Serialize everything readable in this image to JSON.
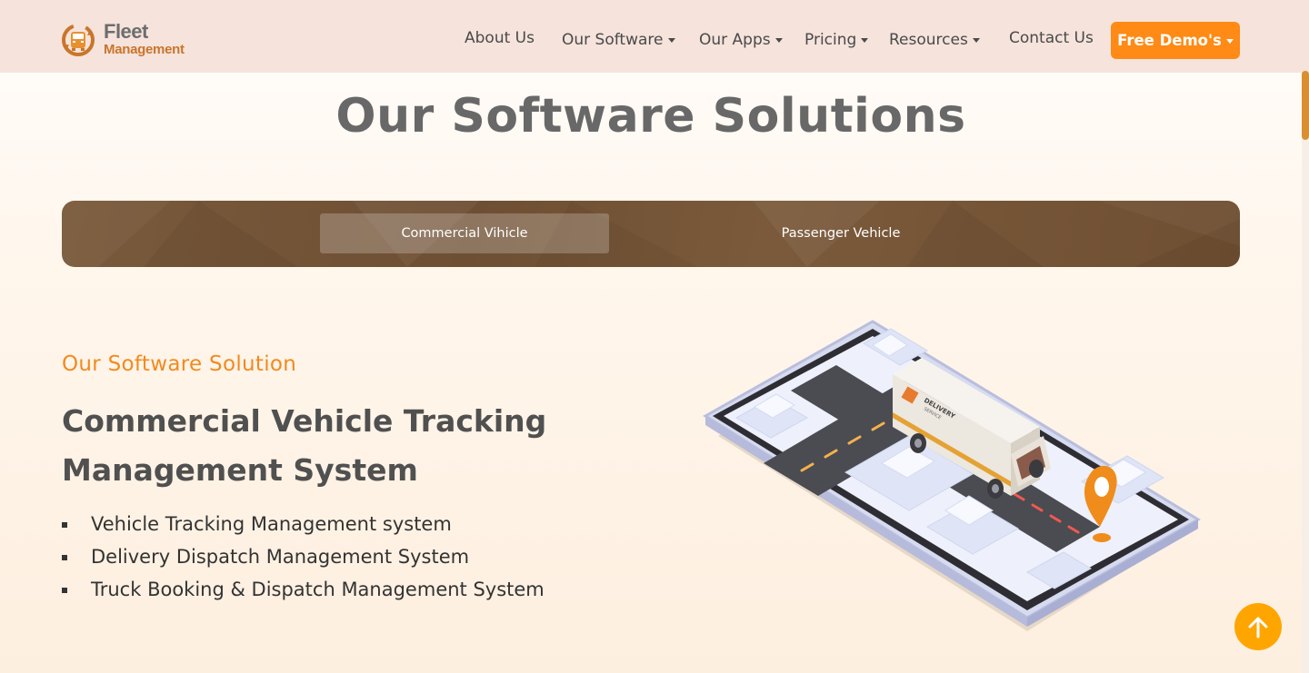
{
  "brand": {
    "name_line1": "Fleet",
    "name_line2": "Management",
    "logo_icon": "truck-cycle-logo-icon",
    "primary_color": "#ff8a15",
    "accent_color": "#f28a1e",
    "tab_bar_color": "#75553a"
  },
  "nav": {
    "items": [
      {
        "label": "About Us",
        "has_dropdown": false
      },
      {
        "label": "Our Software",
        "has_dropdown": true
      },
      {
        "label": "Our Apps",
        "has_dropdown": true
      },
      {
        "label": "Pricing",
        "has_dropdown": true
      },
      {
        "label": "Resources",
        "has_dropdown": true
      },
      {
        "label": "Contact Us",
        "has_dropdown": false
      }
    ],
    "cta_label": "Free Demo's"
  },
  "page": {
    "title": "Our Software Solutions"
  },
  "tabs": [
    {
      "label": "Commercial Vihicle",
      "active": true
    },
    {
      "label": "Passenger Vehicle",
      "active": false
    }
  ],
  "content": {
    "eyebrow": "Our Software Solution",
    "headline": "Commercial Vehicle Tracking Management System",
    "features": [
      "Vehicle Tracking Management system",
      "Delivery Dispatch Management System",
      "Truck Booking & Dispatch Management System"
    ],
    "illustration": {
      "icon": "phone-delivery-truck-map-illustration",
      "truck_text_line1": "DELIVERY",
      "truck_text_line2": "SERVICE"
    }
  },
  "back_to_top_icon": "arrow-up-icon"
}
